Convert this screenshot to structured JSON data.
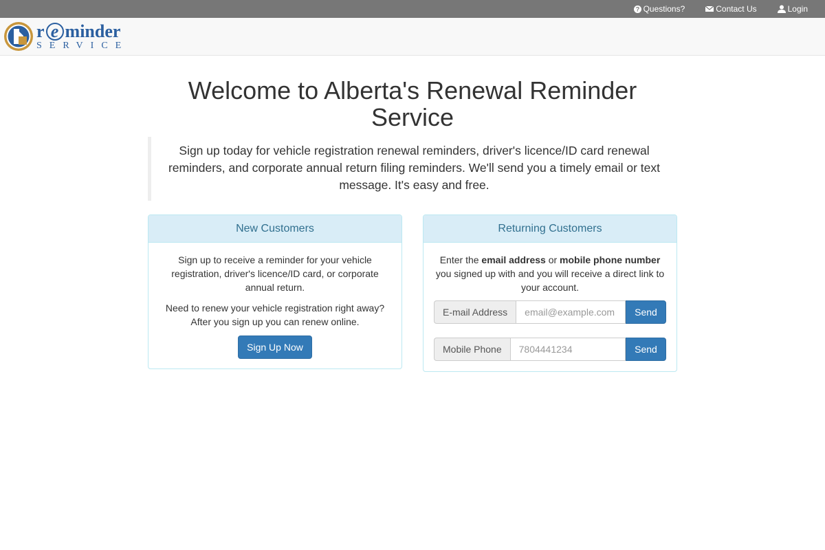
{
  "topnav": {
    "questions": "Questions?",
    "contact": "Contact Us",
    "login": "Login"
  },
  "logo": {
    "top_r": "r",
    "top_e": "e",
    "top_rest": "minder",
    "bottom": "SERVICE"
  },
  "page": {
    "title": "Welcome to Alberta's Renewal Reminder Service",
    "lead": "Sign up today for vehicle registration renewal reminders, driver's licence/ID card renewal reminders, and corporate annual return filing reminders. We'll send you a timely email or text message. It's easy and free."
  },
  "new_customers": {
    "heading": "New Customers",
    "text1": "Sign up to receive a reminder for your vehicle registration, driver's licence/ID card, or corporate annual return.",
    "text2": "Need to renew your vehicle registration right away? After you sign up you can renew online.",
    "button": "Sign Up Now"
  },
  "returning_customers": {
    "heading": "Returning Customers",
    "intro_prefix": "Enter the ",
    "intro_bold1": "email address",
    "intro_mid": " or ",
    "intro_bold2": "mobile phone number",
    "intro_suffix": " you signed up with and you will receive a direct link to your account.",
    "email_label": "E-mail Address",
    "email_placeholder": "email@example.com",
    "email_value": "",
    "email_send": "Send",
    "phone_label": "Mobile Phone",
    "phone_placeholder": "7804441234",
    "phone_value": "",
    "phone_send": "Send"
  },
  "colors": {
    "topbar": "#777777",
    "primary": "#337ab7",
    "panel_heading_bg": "#d9edf7",
    "panel_heading_text": "#31708f",
    "logo_blue": "#2b5fa0",
    "logo_gold": "#c8963c"
  },
  "icons": {
    "questions": "question-circle-icon",
    "contact": "envelope-icon",
    "login": "user-icon"
  }
}
